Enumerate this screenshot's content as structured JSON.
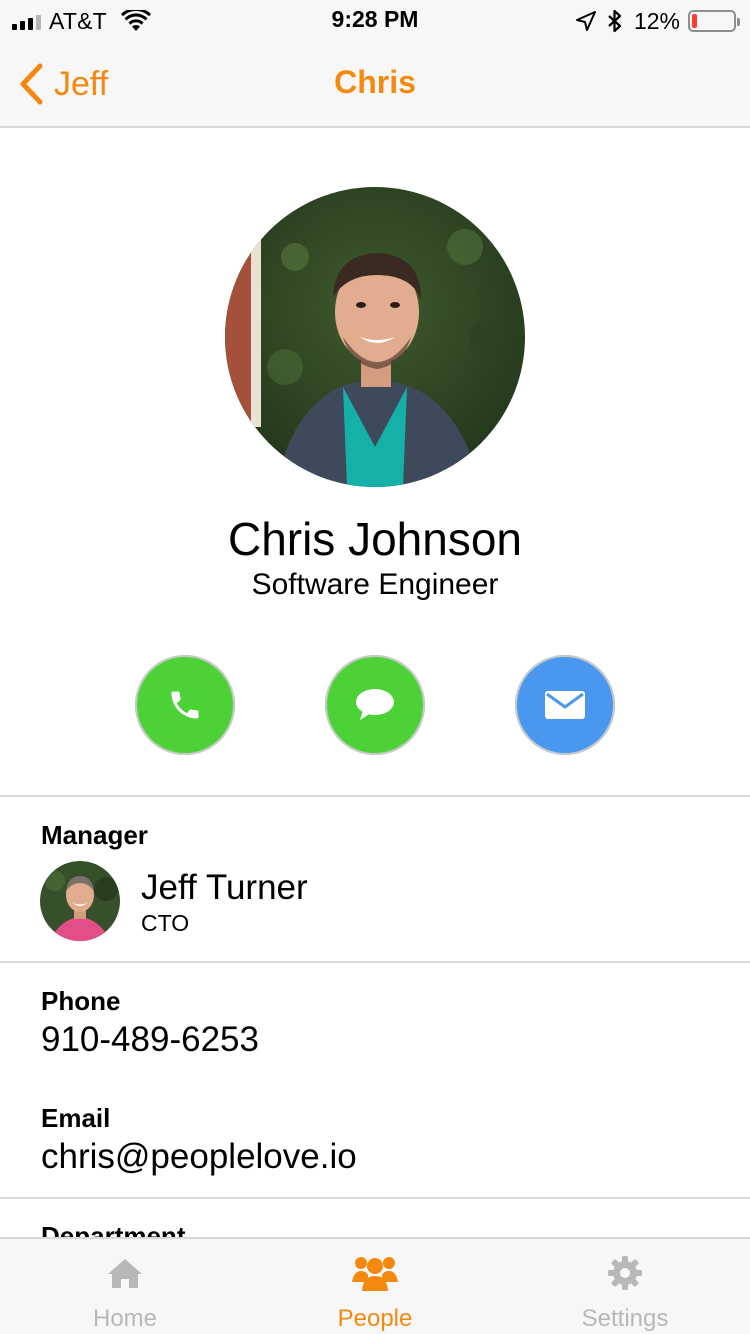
{
  "status_bar": {
    "carrier": "AT&T",
    "time": "9:28 PM",
    "battery": "12%",
    "battery_level": 0.12
  },
  "nav": {
    "back_label": "Jeff",
    "title": "Chris"
  },
  "profile": {
    "name": "Chris Johnson",
    "job_title": "Software Engineer"
  },
  "actions": [
    {
      "name": "call",
      "icon": "phone-icon",
      "color": "#4cd137"
    },
    {
      "name": "message",
      "icon": "chat-bubble-icon",
      "color": "#4cd137"
    },
    {
      "name": "email",
      "icon": "envelope-icon",
      "color": "#4a97f0"
    }
  ],
  "manager": {
    "label": "Manager",
    "name": "Jeff Turner",
    "title": "CTO"
  },
  "phone": {
    "label": "Phone",
    "value": "910-489-6253"
  },
  "email": {
    "label": "Email",
    "value": "chris@peoplelove.io"
  },
  "department": {
    "label": "Department"
  },
  "tabs": [
    {
      "label": "Home",
      "icon": "house-icon",
      "active": false
    },
    {
      "label": "People",
      "icon": "people-icon",
      "active": true
    },
    {
      "label": "Settings",
      "icon": "gear-icon",
      "active": false
    }
  ],
  "colors": {
    "accent": "#f5890f",
    "call_green": "#4cd137",
    "mail_blue": "#4a97f0"
  }
}
